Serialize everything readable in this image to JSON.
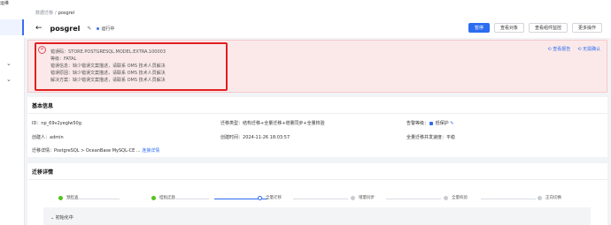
{
  "sidebar": {
    "fragment": "运维"
  },
  "breadcrumb": {
    "parent": "数据迁移",
    "separator": "/",
    "current": "posgrel"
  },
  "header": {
    "title": "posgrel",
    "status": "运行中",
    "buttons": {
      "pause": "暂停",
      "view_objects": "查看对象",
      "view_monitor": "查看组件监控",
      "more": "更多操作"
    }
  },
  "alert": {
    "lines": [
      "错误码：STORE.POSTGRESQL.MODEL.EXTRA.100003",
      "等级：FATAL",
      "错误信息：缺少错误文案描述，请联系 OMS 技术人员解决",
      "错误原因：缺少错误文案描述，请联系 OMS 技术人员解决",
      "解决方案：缺少错误文案描述，请联系 OMS 技术人员解决"
    ],
    "link_view": "查看报告",
    "link_ignore": "无需确认"
  },
  "basic": {
    "title": "基本信息",
    "id_label": "ID：",
    "id_value": "np_69v2yeglw50g",
    "creator_label": "创建人：",
    "creator_value": "admin",
    "link_label": "迁移详情：",
    "link_value": "PostgreSQL > OceanBase MySQL-CE ...",
    "link_detail": "连接详情",
    "type_label": "迁移类型：",
    "type_value": "结构迁移+全量迁移+增量同步+全量校验",
    "created_label": "创建时间：",
    "created_value": "2024-11-26 18:03:57",
    "alarm_label": "告警等级：",
    "alarm_value": "低保护",
    "concurrency_label": "全量迁移并发速度：",
    "concurrency_value": "平稳"
  },
  "details": {
    "title": "迁移详情",
    "steps": [
      "预检查",
      "结构迁移",
      "全量迁移",
      "增量同步",
      "全量校验",
      "正向切换"
    ],
    "progress_text": "初始化中"
  }
}
